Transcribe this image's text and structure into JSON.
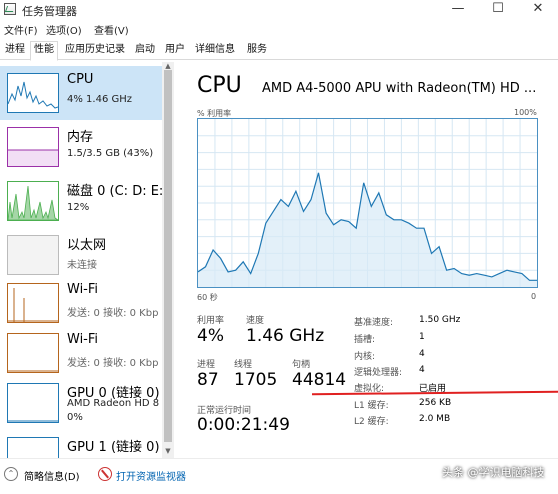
{
  "window": {
    "title": "任务管理器",
    "minimize": "—",
    "maximize": "☐",
    "close": "✕"
  },
  "menu": [
    "文件(F)",
    "选项(O)",
    "查看(V)"
  ],
  "tabs": [
    "进程",
    "性能",
    "应用历史记录",
    "启动",
    "用户",
    "详细信息",
    "服务"
  ],
  "active_tab": "性能",
  "resources": [
    {
      "name": "CPU",
      "sub1": "4% 1.46 GHz",
      "sub2": ""
    },
    {
      "name": "内存",
      "sub1": "1.5/3.5 GB (43%)",
      "sub2": ""
    },
    {
      "name": "磁盘 0 (C: D: E:",
      "sub1": "12%",
      "sub2": ""
    },
    {
      "name": "以太网",
      "sub1": "未连接",
      "sub2": ""
    },
    {
      "name": "Wi-Fi",
      "sub1": "发送: 0 接收: 0 Kbp",
      "sub2": ""
    },
    {
      "name": "Wi-Fi",
      "sub1": "发送: 0 接收: 0 Kbp",
      "sub2": ""
    },
    {
      "name": "GPU 0 (链接 0)",
      "sub1": "AMD Radeon HD 8",
      "sub2": "0%"
    },
    {
      "name": "GPU 1 (链接 0)",
      "sub1": "",
      "sub2": ""
    }
  ],
  "detail": {
    "title": "CPU",
    "model": "AMD A4-5000 APU with Radeon(TM) HD ...",
    "graph_label_left": "% 利用率",
    "graph_label_right": "100%",
    "graph_time_left": "60 秒",
    "graph_time_right": "0",
    "utilization_label": "利用率",
    "utilization_value": "4%",
    "speed_label": "速度",
    "speed_value": "1.46 GHz",
    "processes_label": "进程",
    "processes_value": "87",
    "threads_label": "线程",
    "threads_value": "1705",
    "handles_label": "句柄",
    "handles_value": "44814",
    "uptime_label": "正常运行时间",
    "uptime_value": "0:00:21:49",
    "specs": [
      {
        "label": "基准速度:",
        "value": "1.50 GHz"
      },
      {
        "label": "插槽:",
        "value": "1"
      },
      {
        "label": "内核:",
        "value": "4"
      },
      {
        "label": "逻辑处理器:",
        "value": "4"
      },
      {
        "label": "虚拟化:",
        "value": "已启用"
      },
      {
        "label": "L1 缓存:",
        "value": "256 KB"
      },
      {
        "label": "L2 缓存:",
        "value": "2.0 MB"
      }
    ]
  },
  "cpu_history_percent": [
    9,
    12,
    22,
    17,
    9,
    10,
    15,
    8,
    20,
    38,
    45,
    52,
    48,
    57,
    45,
    52,
    68,
    44,
    37,
    40,
    39,
    35,
    62,
    48,
    56,
    43,
    40,
    40,
    38,
    35,
    35,
    20,
    24,
    10,
    11,
    8,
    7,
    8,
    7,
    6,
    8,
    10,
    9,
    8,
    4,
    4
  ],
  "bottom": {
    "fewer_details": "简略信息(D)",
    "open_monitor": "打开资源监视器"
  },
  "watermark": "头条 @学识电脑科技",
  "colors": {
    "cpu_line": "#1f78b4",
    "memory_line": "#9b30a8",
    "disk_line": "#4caf50",
    "wifi_line": "#b5651d",
    "gpu_line": "#1f78b4",
    "link": "#0063b1"
  }
}
